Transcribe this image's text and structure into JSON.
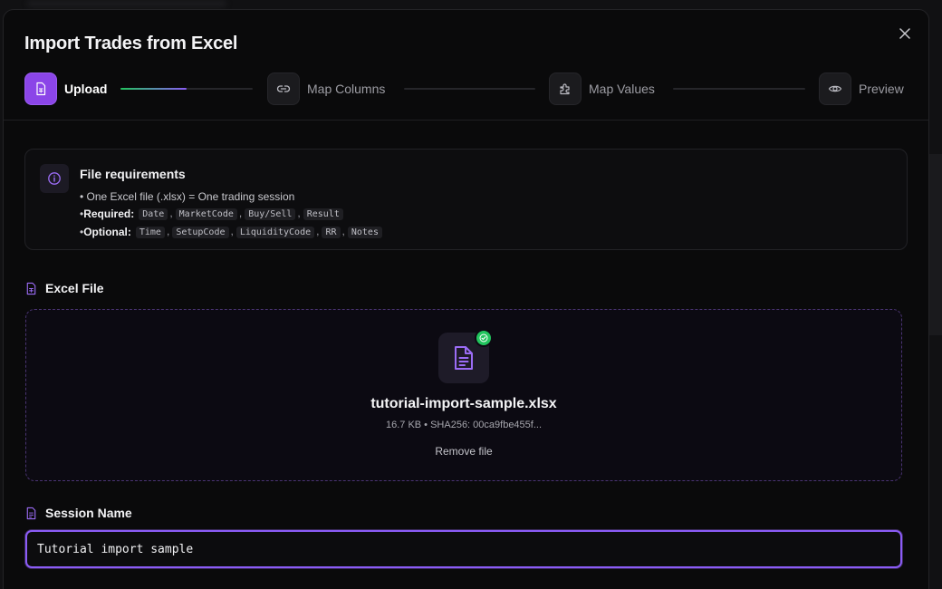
{
  "modal": {
    "title": "Import Trades from Excel",
    "close_icon": "close-icon"
  },
  "stepper": {
    "steps": [
      {
        "label": "Upload",
        "icon": "spreadsheet-icon",
        "state": "active"
      },
      {
        "label": "Map Columns",
        "icon": "link-icon",
        "state": "upcoming"
      },
      {
        "label": "Map Values",
        "icon": "puzzle-icon",
        "state": "upcoming"
      },
      {
        "label": "Preview",
        "icon": "eye-icon",
        "state": "upcoming"
      }
    ],
    "progress_first_connector": 0.5,
    "progress_colors": [
      "#22c55e",
      "#8b5cf6"
    ]
  },
  "requirements": {
    "icon": "info-icon",
    "title": "File requirements",
    "line1": "• One Excel file (.xlsx) = One trading session",
    "required_prefix": "• ",
    "required_label": "Required:",
    "required_fields": [
      "Date",
      "MarketCode",
      "Buy/Sell",
      "Result"
    ],
    "optional_prefix": "• ",
    "optional_label": "Optional:",
    "optional_fields": [
      "Time",
      "SetupCode",
      "LiquidityCode",
      "RR",
      "Notes"
    ]
  },
  "excel_file": {
    "label": "Excel File",
    "file_name": "tutorial-import-sample.xlsx",
    "file_meta": "16.7 KB • SHA256: 00ca9fbe455f...",
    "remove_label": "Remove file",
    "status": "uploaded"
  },
  "session": {
    "label": "Session Name",
    "value": "Tutorial import sample"
  },
  "colors": {
    "accent": "#8b5cf6",
    "accent_active_step": "#8b45e8",
    "success": "#22c55e",
    "background": "#0a0a0b"
  }
}
